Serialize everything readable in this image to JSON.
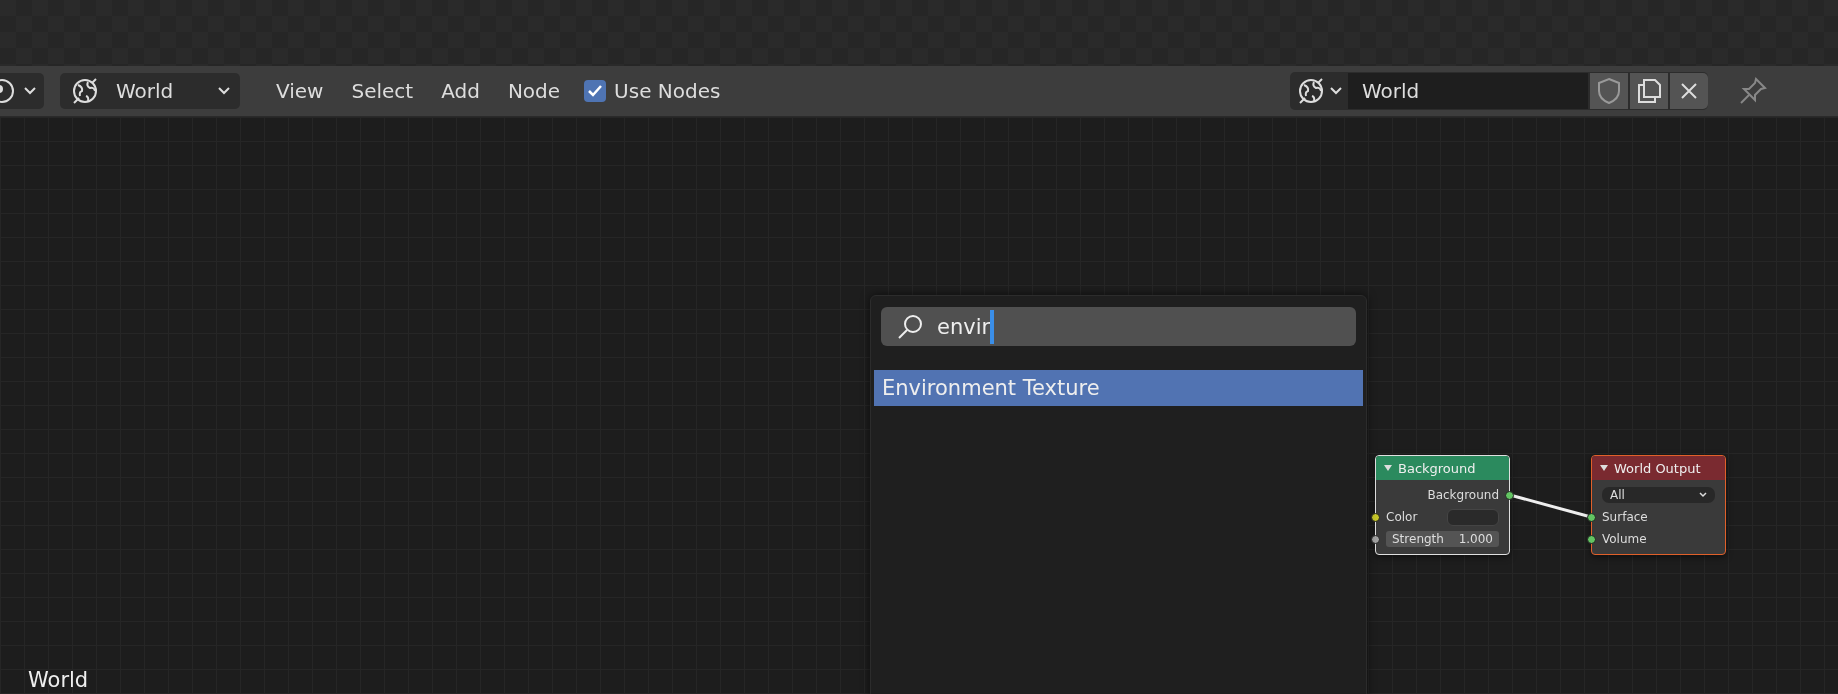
{
  "header": {
    "world_dropdown": {
      "label": "World"
    },
    "menus": [
      "View",
      "Select",
      "Add",
      "Node"
    ],
    "use_nodes": {
      "label": "Use Nodes",
      "checked": true
    },
    "datablock": {
      "name": "World"
    }
  },
  "search_popup": {
    "query": "envir",
    "results": [
      {
        "label": "Environment Texture",
        "selected": true
      }
    ]
  },
  "nodes": [
    {
      "title": "Background",
      "color": "#2b8a5e",
      "rows": [
        {
          "kind": "output",
          "label": "Background"
        },
        {
          "kind": "color_input",
          "label": "Color"
        },
        {
          "kind": "value_input",
          "label": "Strength",
          "value": "1.000"
        }
      ]
    },
    {
      "title": "World Output",
      "color": "#7a2a30",
      "rows": [
        {
          "kind": "dropdown",
          "label": "All"
        },
        {
          "kind": "input",
          "label": "Surface"
        },
        {
          "kind": "input",
          "label": "Volume"
        }
      ]
    }
  ],
  "view_label": "World"
}
